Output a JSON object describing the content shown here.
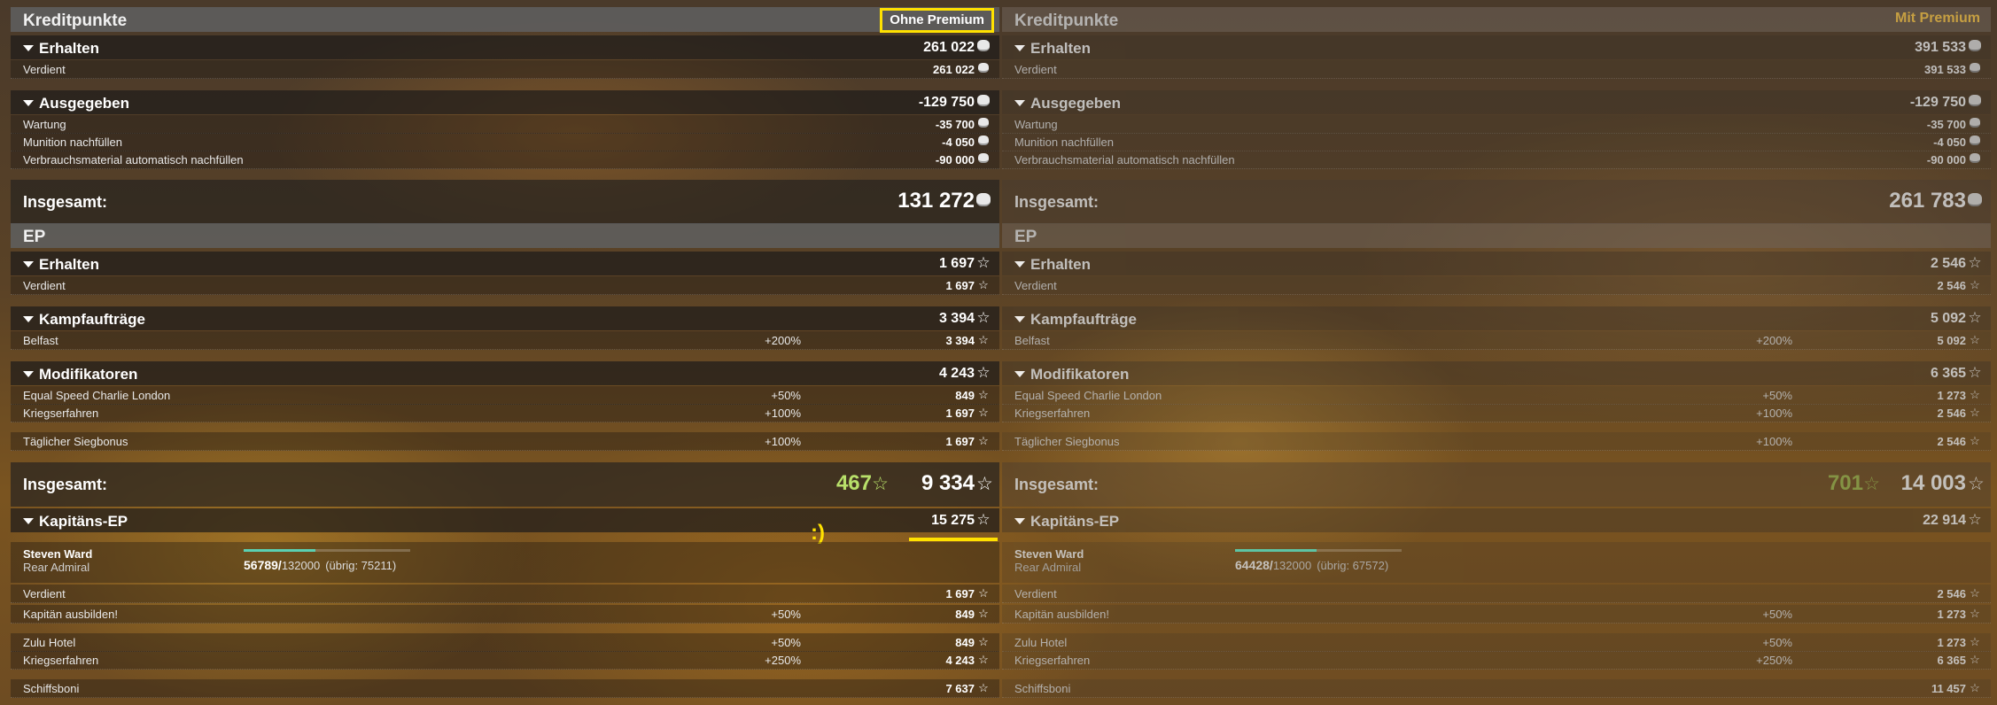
{
  "left": {
    "credits": {
      "title": "Kreditpunkte",
      "premium_label": "Ohne Premium",
      "received": {
        "label": "Erhalten",
        "value": "261 022"
      },
      "earned": {
        "label": "Verdient",
        "value": "261 022"
      },
      "spent": {
        "label": "Ausgegeben",
        "value": "-129 750"
      },
      "maintenance": {
        "label": "Wartung",
        "value": "-35 700"
      },
      "ammo": {
        "label": "Munition nachfüllen",
        "value": "-4 050"
      },
      "consumables": {
        "label": "Verbrauchsmaterial automatisch nachfüllen",
        "value": "-90 000"
      },
      "total": {
        "label": "Insgesamt:",
        "value": "131 272"
      }
    },
    "xp": {
      "title": "EP",
      "received": {
        "label": "Erhalten",
        "value": "1 697"
      },
      "earned": {
        "label": "Verdient",
        "value": "1 697"
      },
      "combat_missions": {
        "label": "Kampfaufträge",
        "value": "3 394"
      },
      "belfast": {
        "label": "Belfast",
        "pct": "+200%",
        "value": "3 394"
      },
      "modifiers": {
        "label": "Modifikatoren",
        "value": "4 243"
      },
      "equal_speed": {
        "label": "Equal Speed Charlie London",
        "pct": "+50%",
        "value": "849"
      },
      "war_experience": {
        "label": "Kriegserfahren",
        "pct": "+100%",
        "value": "1 697"
      },
      "daily_win": {
        "label": "Täglicher Siegbonus",
        "pct": "+100%",
        "value": "1 697"
      },
      "total": {
        "label": "Insgesamt:",
        "bonus": "467",
        "value": "9 334"
      }
    },
    "captain": {
      "title": "Kapitäns-EP",
      "value": "15 275",
      "smiley": ":)",
      "name": "Steven Ward",
      "rank": "Rear Admiral",
      "progress_current": "56789/",
      "progress_total": "132000",
      "progress_remaining": "(übrig: 75211)",
      "progress_fraction": 0.43,
      "earned": {
        "label": "Verdient",
        "value": "1 697"
      },
      "train": {
        "label": "Kapitän ausbilden!",
        "pct": "+50%",
        "value": "849"
      },
      "zulu_hotel": {
        "label": "Zulu Hotel",
        "pct": "+50%",
        "value": "849"
      },
      "war_experience": {
        "label": "Kriegserfahren",
        "pct": "+250%",
        "value": "4 243"
      },
      "ship_bonus": {
        "label": "Schiffsboni",
        "value": "7 637"
      }
    }
  },
  "right": {
    "credits": {
      "title": "Kreditpunkte",
      "premium_label": "Mit Premium",
      "received": {
        "label": "Erhalten",
        "value": "391 533"
      },
      "earned": {
        "label": "Verdient",
        "value": "391 533"
      },
      "spent": {
        "label": "Ausgegeben",
        "value": "-129 750"
      },
      "maintenance": {
        "label": "Wartung",
        "value": "-35 700"
      },
      "ammo": {
        "label": "Munition nachfüllen",
        "value": "-4 050"
      },
      "consumables": {
        "label": "Verbrauchsmaterial automatisch nachfüllen",
        "value": "-90 000"
      },
      "total": {
        "label": "Insgesamt:",
        "value": "261 783"
      }
    },
    "xp": {
      "title": "EP",
      "received": {
        "label": "Erhalten",
        "value": "2 546"
      },
      "earned": {
        "label": "Verdient",
        "value": "2 546"
      },
      "combat_missions": {
        "label": "Kampfaufträge",
        "value": "5 092"
      },
      "belfast": {
        "label": "Belfast",
        "pct": "+200%",
        "value": "5 092"
      },
      "modifiers": {
        "label": "Modifikatoren",
        "value": "6 365"
      },
      "equal_speed": {
        "label": "Equal Speed Charlie London",
        "pct": "+50%",
        "value": "1 273"
      },
      "war_experience": {
        "label": "Kriegserfahren",
        "pct": "+100%",
        "value": "2 546"
      },
      "daily_win": {
        "label": "Täglicher Siegbonus",
        "pct": "+100%",
        "value": "2 546"
      },
      "total": {
        "label": "Insgesamt:",
        "bonus": "701",
        "value": "14 003"
      }
    },
    "captain": {
      "title": "Kapitäns-EP",
      "value": "22 914",
      "name": "Steven Ward",
      "rank": "Rear Admiral",
      "progress_current": "64428/",
      "progress_total": "132000",
      "progress_remaining": "(übrig: 67572)",
      "progress_fraction": 0.49,
      "earned": {
        "label": "Verdient",
        "value": "2 546"
      },
      "train": {
        "label": "Kapitän ausbilden!",
        "pct": "+50%",
        "value": "1 273"
      },
      "zulu_hotel": {
        "label": "Zulu Hotel",
        "pct": "+50%",
        "value": "1 273"
      },
      "war_experience": {
        "label": "Kriegserfahren",
        "pct": "+250%",
        "value": "6 365"
      },
      "ship_bonus": {
        "label": "Schiffsboni",
        "value": "11 457"
      }
    }
  },
  "icons": {
    "credit": "credit-coin-icon",
    "xp": "xp-star-icon",
    "star_glyph": "☆",
    "star_outline": "☆"
  },
  "colors": {
    "highlight": "#ffe100",
    "bonus_xp": "#b8e06a",
    "premium_gold": "#d4aa45",
    "progress": "#5ad0b2"
  }
}
